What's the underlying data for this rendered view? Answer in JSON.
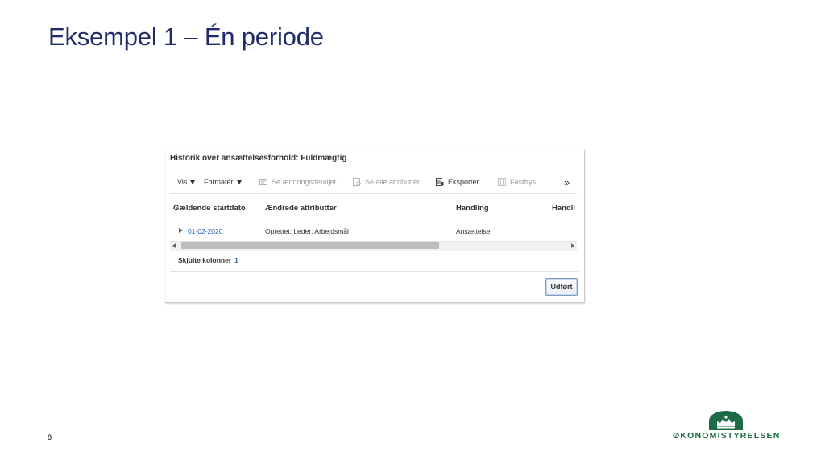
{
  "slide": {
    "title": "Eksempel 1 – Én periode",
    "page_number": "8",
    "logo_text": "ØKONOMISTYRELSEN",
    "brand_color": "#1c6b45",
    "title_color": "#1f2a6b"
  },
  "screenshot": {
    "panel_title": "Historik over ansættelsesforhold: Fuldmægtig",
    "toolbar": {
      "view_label": "Vis",
      "format_label": "Formatér",
      "change_details_label": "Se ændringsdetaljer",
      "all_attributes_label": "Se alle attributter",
      "export_label": "Eksporter",
      "freeze_label": "Fastfrys",
      "overflow_icon": "double-chevron-right-icon"
    },
    "table": {
      "columns": [
        "Gældende startdato",
        "Ændrede attributter",
        "Handling",
        "Handli"
      ],
      "rows": [
        {
          "start_date": "01-02-2020",
          "changed_attributes": "Oprettet: Leder; Arbejdsmål",
          "action": "Ansættelse"
        }
      ]
    },
    "hidden_columns_label": "Skjulte kolonner",
    "hidden_columns_count": "1",
    "done_button_label": "Udført"
  }
}
